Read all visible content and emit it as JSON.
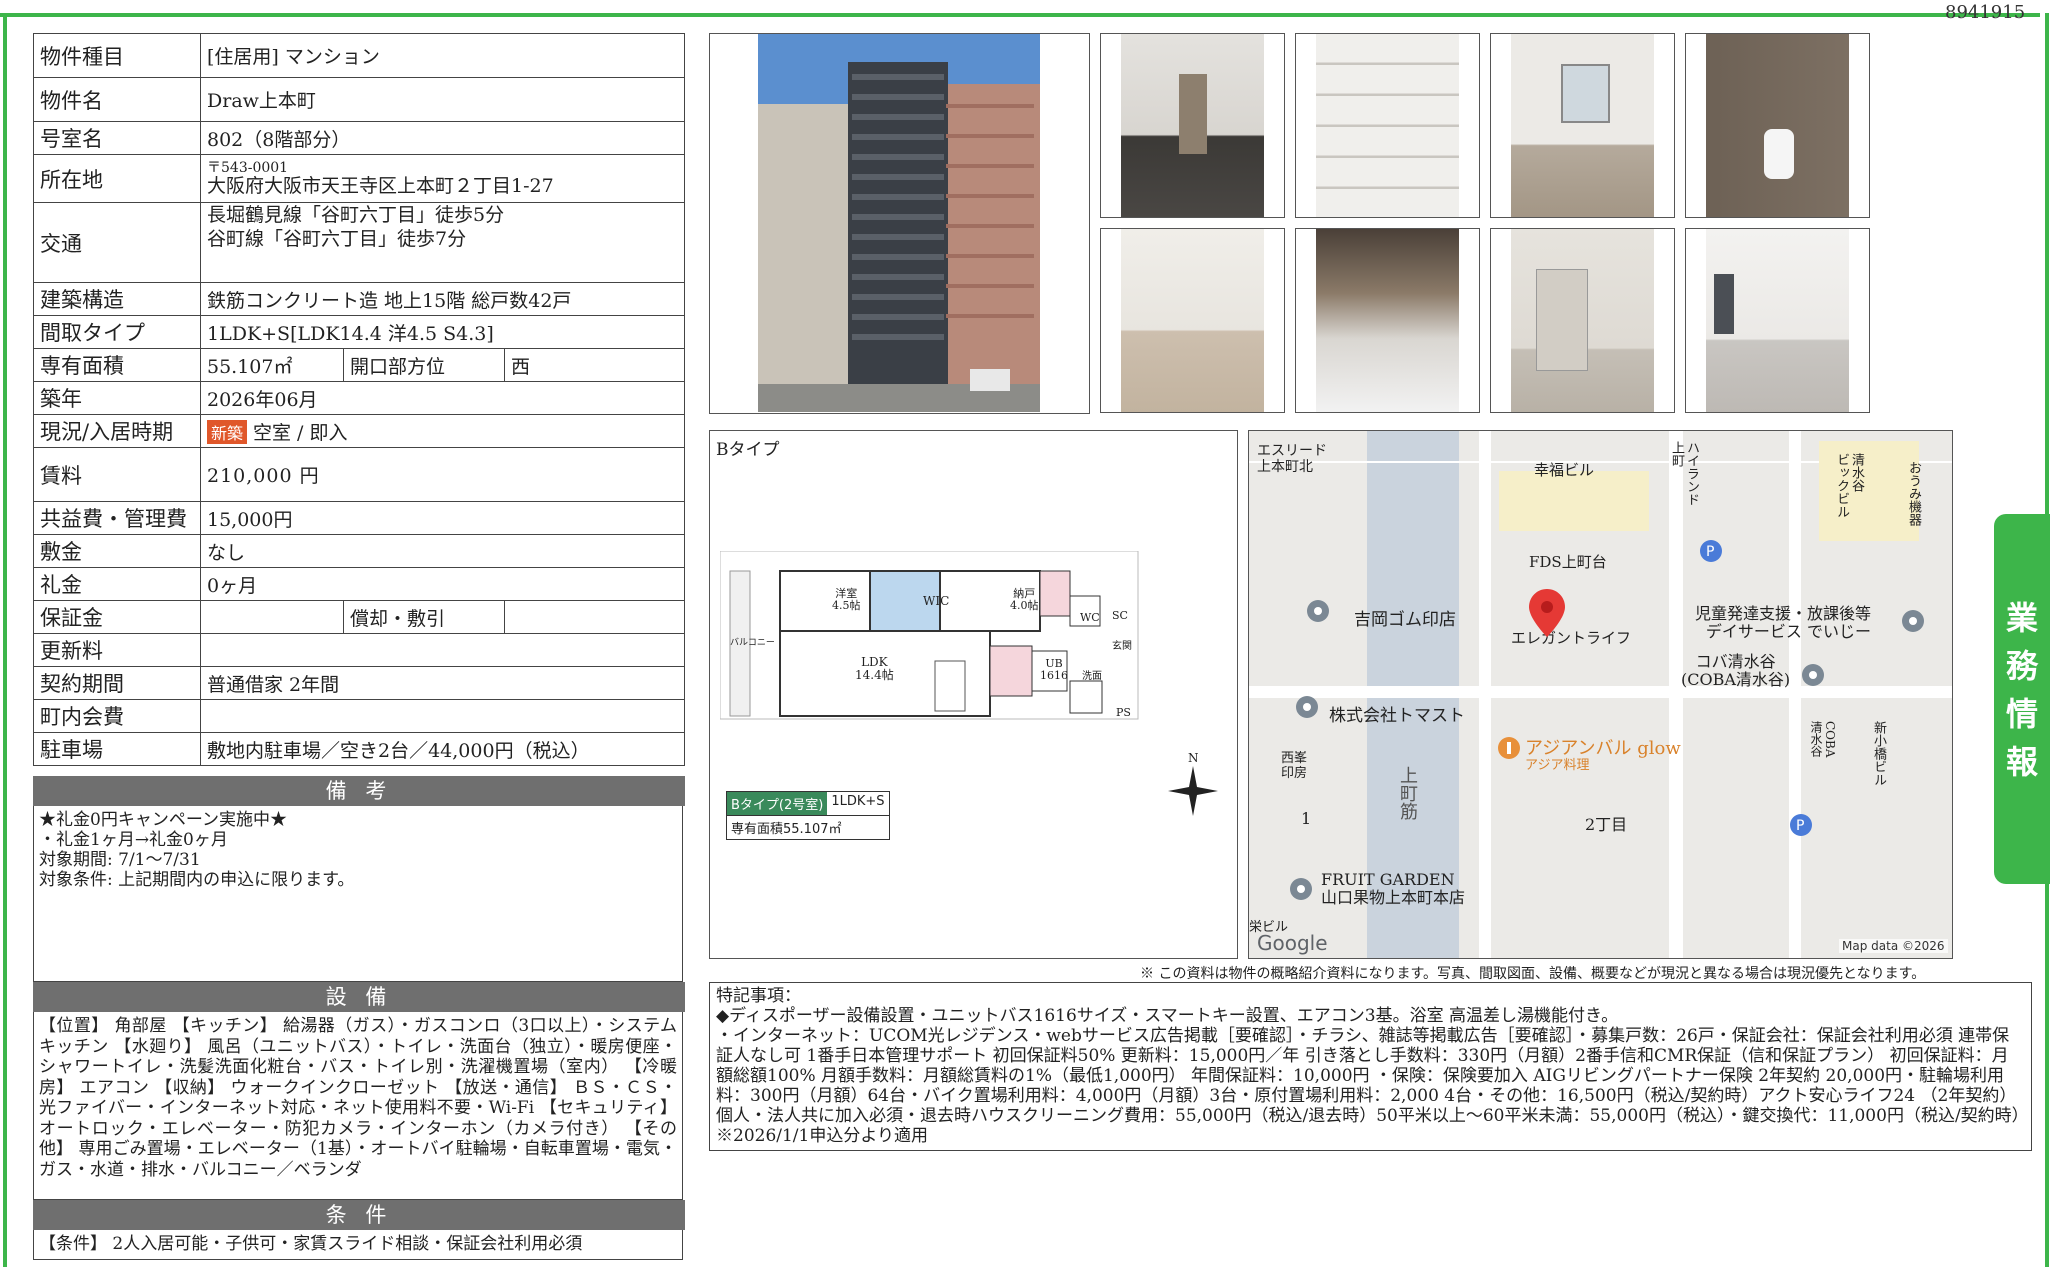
{
  "doc_id": "8941915",
  "property": {
    "rows": [
      {
        "label": "物件種目",
        "value": "[住居用] マンション"
      },
      {
        "label": "物件名",
        "value": "Draw上本町"
      },
      {
        "label": "号室名",
        "value": "802（8階部分）"
      },
      {
        "label": "所在地",
        "postal": "〒543-0001",
        "value": "大阪府大阪市天王寺区上本町２丁目1-27"
      },
      {
        "label": "交通",
        "line1": "長堀鶴見線「谷町六丁目」徒歩5分",
        "line2": "谷町線「谷町六丁目」徒歩7分"
      },
      {
        "label": "建築構造",
        "value": "鉄筋コンクリート造 地上15階 総戸数42戸"
      },
      {
        "label": "間取タイプ",
        "value": "1LDK+S[LDK14.4 洋4.5 S4.3]"
      },
      {
        "label": "専有面積",
        "value": "55.107㎡",
        "sub_label": "開口部方位",
        "sub_value": "西"
      },
      {
        "label": "築年",
        "value": "2026年06月"
      },
      {
        "label": "現況/入居時期",
        "badge": "新築",
        "value": "空室 / 即入"
      },
      {
        "label": "賃料",
        "value": "210,000 円"
      },
      {
        "label": "共益費・管理費",
        "value": "15,000円"
      },
      {
        "label": "敷金",
        "value": "なし"
      },
      {
        "label": "礼金",
        "value": "0ヶ月"
      },
      {
        "label": "保証金",
        "value": "",
        "sub_label": "償却・敷引",
        "sub_value": ""
      },
      {
        "label": "更新料",
        "value": ""
      },
      {
        "label": "契約期間",
        "value": "普通借家 2年間"
      },
      {
        "label": "町内会費",
        "value": ""
      },
      {
        "label": "駐車場",
        "value": "敷地内駐車場／空き2台／44,000円（税込）"
      }
    ]
  },
  "remarks": {
    "title": "備 考",
    "lines": [
      "★礼金0円キャンペーン実施中★",
      "・礼金1ヶ月→礼金0ヶ月",
      "対象期間: 7/1〜7/31",
      "対象条件: 上記期間内の申込に限ります。"
    ]
  },
  "facilities": {
    "title": "設 備",
    "text": "【位置】 角部屋 【キッチン】 給湯器（ガス）・ガスコンロ（3口以上）・システムキッチン 【水廻り】 風呂（ユニットバス）・トイレ・洗面台（独立）・暖房便座・シャワートイレ・洗髪洗面化粧台・バス・トイレ別・洗濯機置場（室内） 【冷暖房】 エアコン 【収納】 ウォークインクローゼット 【放送・通信】 ＢＳ・ＣＳ・光ファイバー・インターネット対応・ネット使用料不要・Wi-Fi 【セキュリティ】 オートロック・エレベーター・防犯カメラ・インターホン（カメラ付き） 【その他】 専用ごみ置場・エレベーター（1基）・オートバイ駐輪場・自転車置場・電気・ガス・水道・排水・バルコニー／ベランダ"
  },
  "conditions": {
    "title": "条 件",
    "text": "【条件】 2人入居可能・子供可・家賃スライド相談・保証会社利用必須"
  },
  "floorplan": {
    "type_label": "Bタイプ",
    "rooms": {
      "western": "洋室\n4.5帖",
      "wic": "WIC",
      "storage": "納戸\n4.0帖",
      "ldk": "LDK\n14.4帖",
      "ub": "UB\n1616",
      "wash": "洗面",
      "wc": "WC",
      "sc": "SC",
      "entrance": "玄関",
      "ps": "PS",
      "balcony": "バルコニー"
    },
    "caption_type": "Bタイプ(2号室)",
    "caption_layout": "1LDK+S",
    "caption_area": "専有面積55.107㎡",
    "north": "N"
  },
  "map": {
    "labels": [
      {
        "t": "エスリード\n上本町北"
      },
      {
        "t": "幸福ビル"
      },
      {
        "t": "ハイランド\n上町"
      },
      {
        "t": "清水谷\nビックビル"
      },
      {
        "t": "おうみ機器"
      },
      {
        "t": "FDS上町台"
      },
      {
        "t": "吉岡ゴム印店"
      },
      {
        "t": "エレガントライフ"
      },
      {
        "t": "児童発達支援・放課後等\nデイサービス でいじー"
      },
      {
        "t": "コバ清水谷\n(COBA清水谷)"
      },
      {
        "t": "株式会社トマスト"
      },
      {
        "t": "アジアンバル glow"
      },
      {
        "t": "アジア料理"
      },
      {
        "t": "西峯\n印房"
      },
      {
        "t": "上町筋"
      },
      {
        "t": "2丁目"
      },
      {
        "t": "COBA\n清水谷"
      },
      {
        "t": "新小橋ビル"
      },
      {
        "t": "1"
      },
      {
        "t": "FRUIT GARDEN\n山口果物上本町本店"
      },
      {
        "t": "栄ビル"
      }
    ],
    "google": "Google",
    "credit": "Map data ©2026"
  },
  "disclaimer": "※ この資料は物件の概略紹介資料になります。写真、間取図面、設備、概要などが現況と異なる場合は現況優先となります。",
  "special": {
    "text": "特記事項：\n◆ディスポーザー設備設置・ユニットバス1616サイズ・スマートキー設置、エアコン3基。浴室 高温差し湯機能付き。\n・インターネット：UCOM光レジデンス・webサービス広告掲載［要確認］・チラシ、雑誌等掲載広告［要確認］・募集戸数：26戸・保証会社：保証会社利用必須 連帯保証人なし可 1番手日本管理サポート 初回保証料50% 更新料：15,000円／年 引き落とし手数料：330円（月額）2番手信和CMR保証（信和保証プラン） 初回保証料：月額総額100% 月額手数料：月額総賃料の1%（最低1,000円） 年間保証料：10,000円 ・保険：保険要加入 AIGリビングパートナー保険 2年契約 20,000円・駐輪場利用料：300円（月額）64台・バイク置場利用料：4,000円（月額）3台・原付置場利用料：2,000 4台・その他：16,500円（税込/契約時）アクト安心ライフ24 （2年契約）個人・法人共に加入必須・退去時ハウスクリーニング費用：55,000円（税込/退去時）50平米以上〜60平米未満：55,000円（税込）・鍵交換代：11,000円（税込/契約時）※2026/1/1申込分より適用"
  },
  "side_tab": "業務情報",
  "colors": {
    "accent": "#3db54a",
    "header": "#6f6f6f",
    "badge": "#e0572a",
    "map_bg": "#ebeae7",
    "pin": "#e53935"
  }
}
